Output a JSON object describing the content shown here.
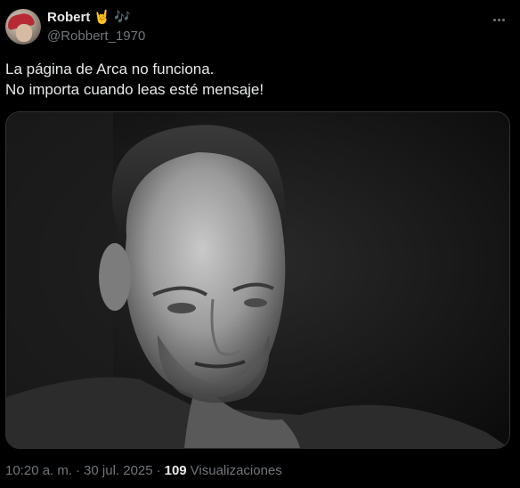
{
  "author": {
    "display_name": "Robert",
    "emoji_rock": "🤘",
    "emoji_notes": "🎶",
    "handle": "@Robbert_1970"
  },
  "tweet": {
    "line1": "La página de Arca no funciona.",
    "line2": "No importa cuando leas esté mensaje!"
  },
  "meta": {
    "time": "10:20 a. m.",
    "sep1": "·",
    "date": "30 jul. 2025",
    "sep2": "·",
    "views_count": "109",
    "views_label": "Visualizaciones"
  },
  "icons": {
    "more": "more-options-icon"
  },
  "colors": {
    "background": "#000000",
    "text_primary": "#e7e9ea",
    "text_secondary": "#71767b"
  }
}
